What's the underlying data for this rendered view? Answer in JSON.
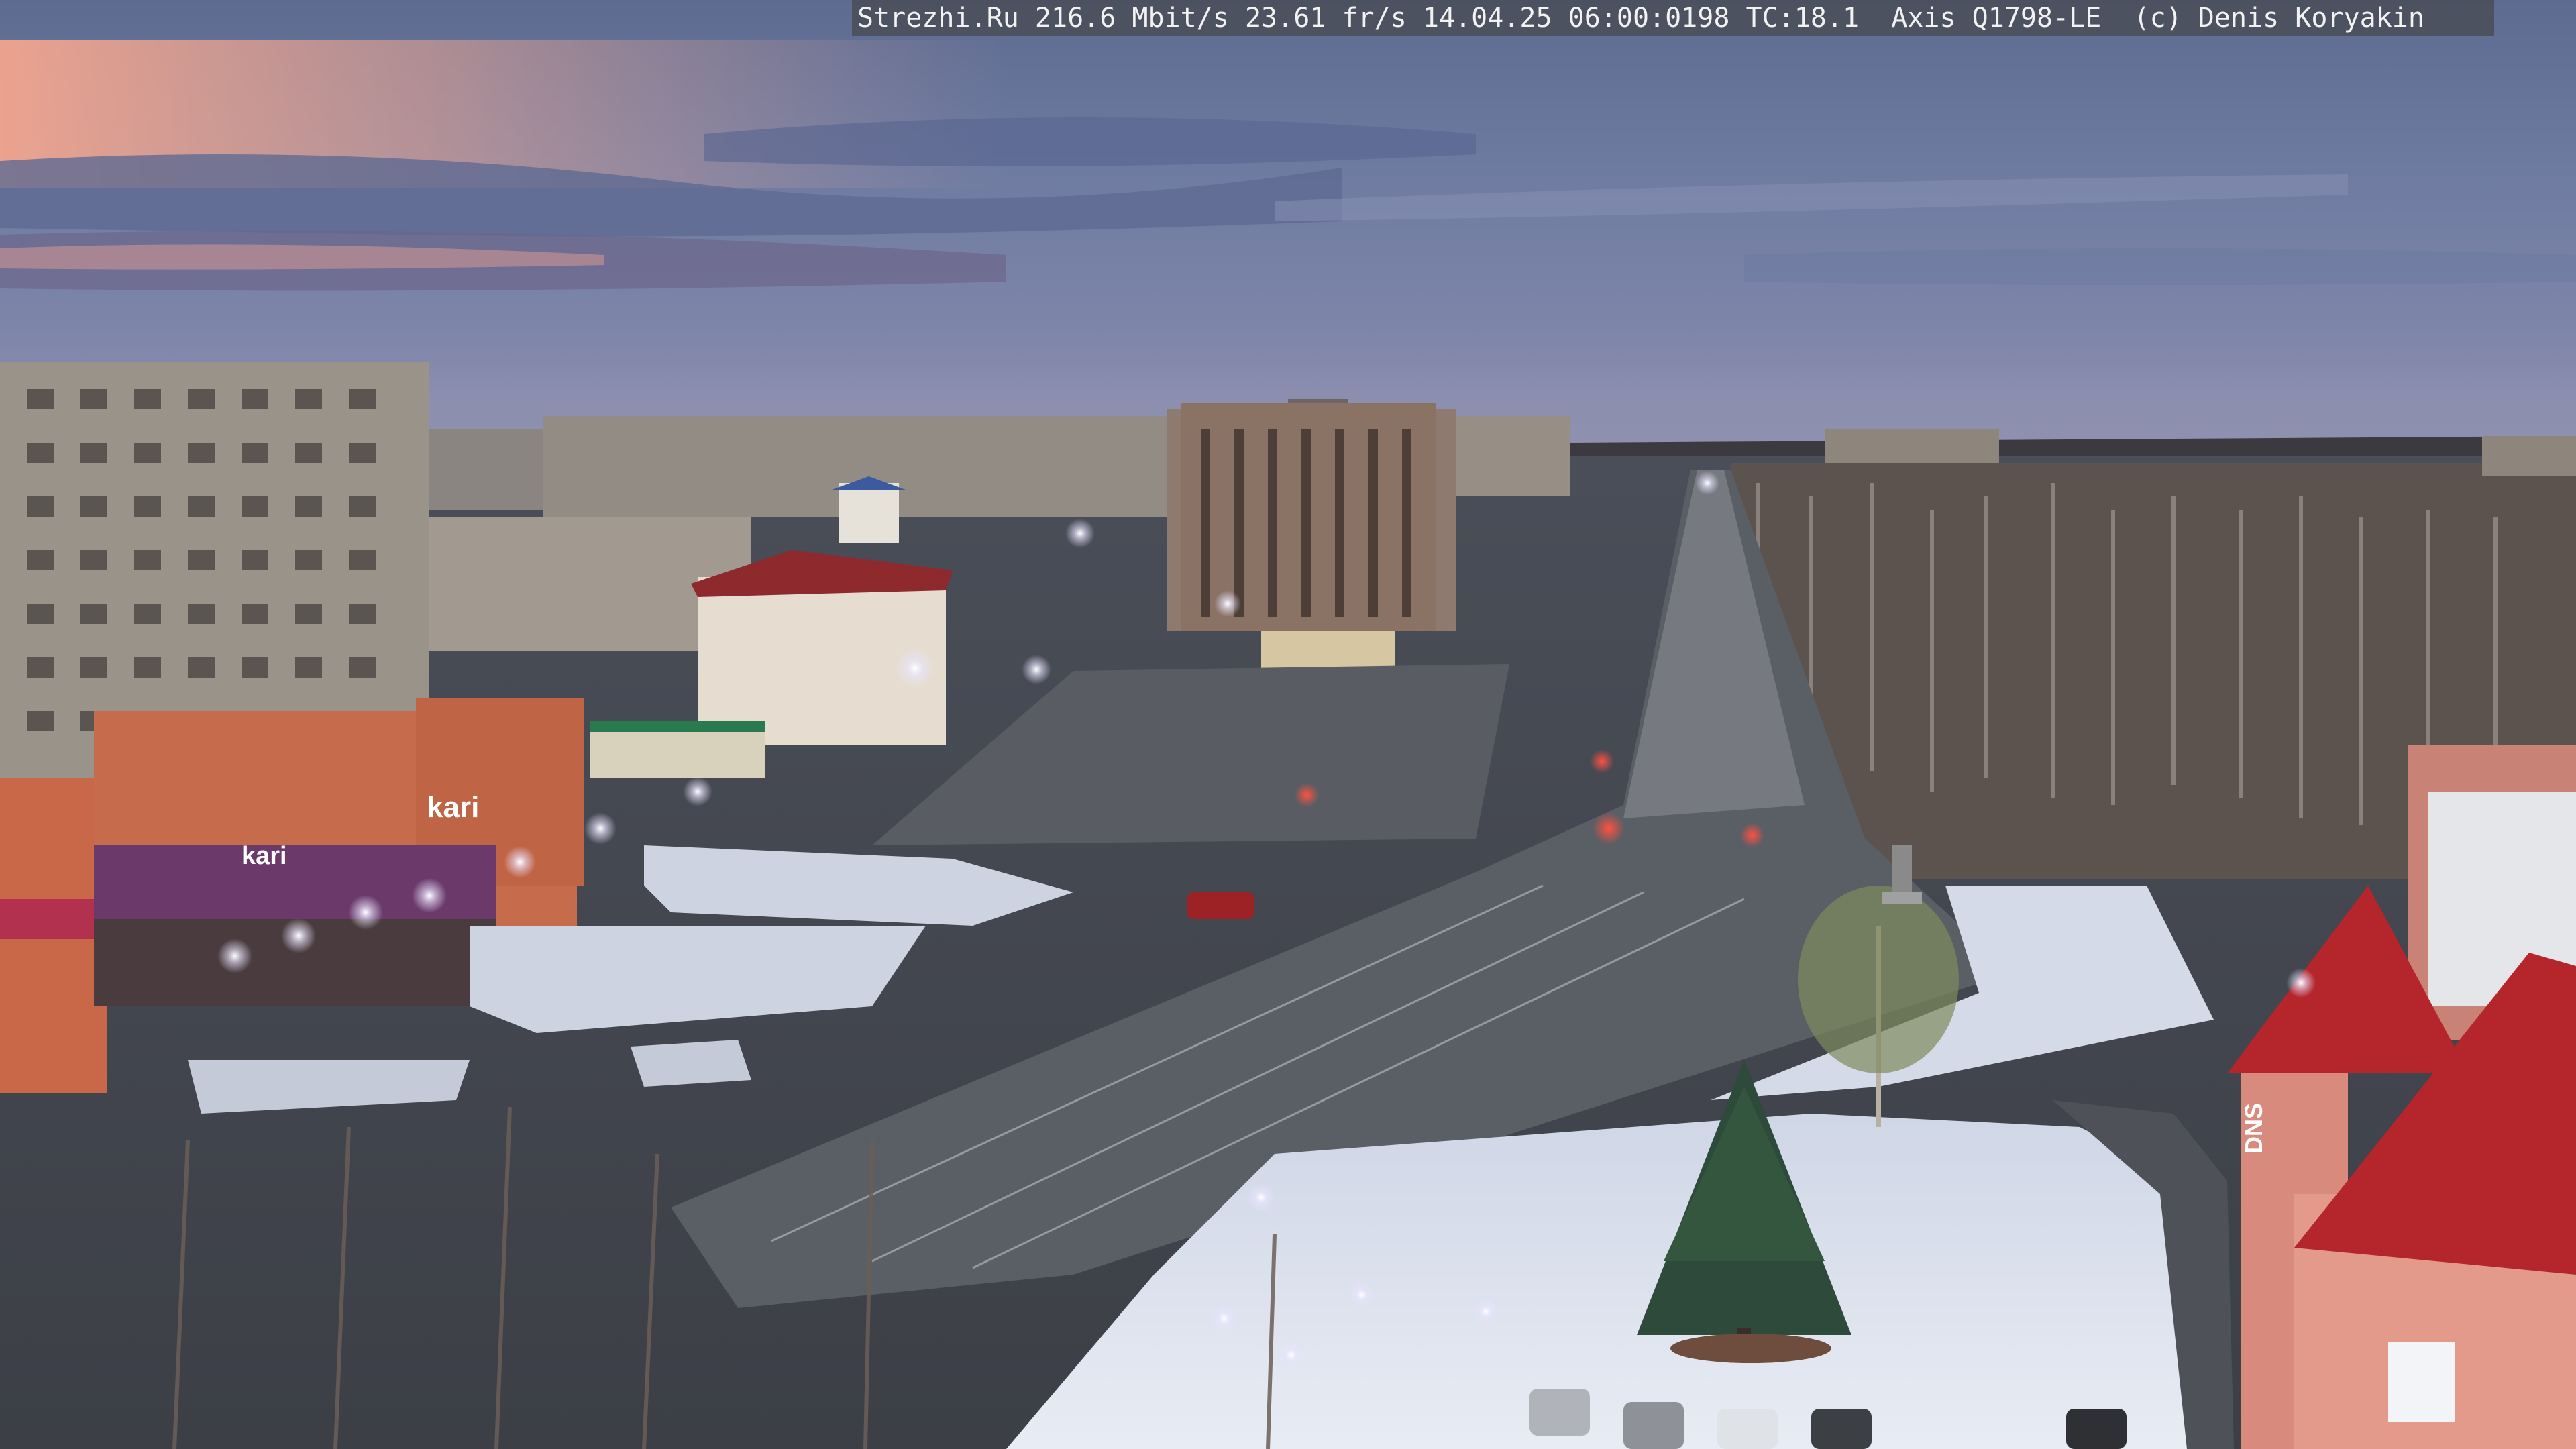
{
  "overlay": {
    "text": "Strezhi.Ru 216.6 Mbit/s 23.61 fr/s 14.04.25 06:00:0198 TC:18.1  Axis Q1798-LE  (c) Denis Koryakin"
  },
  "signs": {
    "kari_large": "kari",
    "kari_small": "kari",
    "dns": "DNS"
  },
  "colors": {
    "sky_top": "#5a6a92",
    "sky_mid": "#6f7ea6",
    "sky_glow": "#e89a88",
    "horizon": "#8c8fb0",
    "snow": "#dde3ee",
    "road": "#5b5f66",
    "brick": "#c86a4a",
    "red_roof": "#b4262c",
    "trees": "#6b5e57",
    "lamp": "#f4f0ff"
  }
}
